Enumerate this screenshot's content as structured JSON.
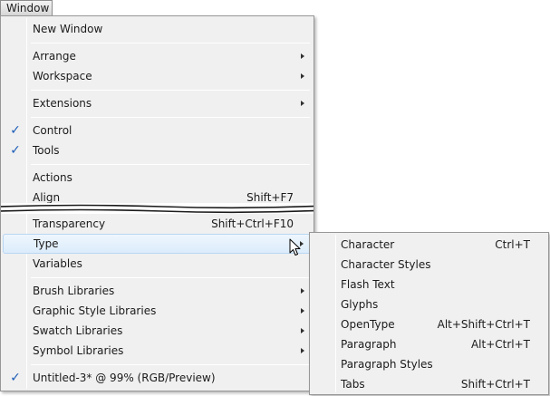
{
  "menubar": {
    "title": "Window"
  },
  "main_menu": {
    "items": [
      {
        "label": "New Window",
        "shortcut": "",
        "submenu": false,
        "checked": false
      },
      {
        "label": "Arrange",
        "shortcut": "",
        "submenu": true,
        "checked": false
      },
      {
        "label": "Workspace",
        "shortcut": "",
        "submenu": true,
        "checked": false
      },
      {
        "label": "Extensions",
        "shortcut": "",
        "submenu": true,
        "checked": false
      },
      {
        "label": "Control",
        "shortcut": "",
        "submenu": false,
        "checked": true
      },
      {
        "label": "Tools",
        "shortcut": "",
        "submenu": false,
        "checked": true
      },
      {
        "label": "Actions",
        "shortcut": "",
        "submenu": false,
        "checked": false
      },
      {
        "label": "Align",
        "shortcut": "Shift+F7",
        "submenu": false,
        "checked": false
      },
      {
        "label": "Transparency",
        "shortcut": "Shift+Ctrl+F10",
        "submenu": false,
        "checked": false
      },
      {
        "label": "Type",
        "shortcut": "",
        "submenu": true,
        "checked": false,
        "highlighted": true
      },
      {
        "label": "Variables",
        "shortcut": "",
        "submenu": false,
        "checked": false
      },
      {
        "label": "Brush Libraries",
        "shortcut": "",
        "submenu": true,
        "checked": false
      },
      {
        "label": "Graphic Style Libraries",
        "shortcut": "",
        "submenu": true,
        "checked": false
      },
      {
        "label": "Swatch Libraries",
        "shortcut": "",
        "submenu": true,
        "checked": false
      },
      {
        "label": "Symbol Libraries",
        "shortcut": "",
        "submenu": true,
        "checked": false
      },
      {
        "label": "Untitled-3* @ 99% (RGB/Preview)",
        "shortcut": "",
        "submenu": false,
        "checked": true
      }
    ]
  },
  "type_submenu": {
    "items": [
      {
        "label": "Character",
        "shortcut": "Ctrl+T"
      },
      {
        "label": "Character Styles",
        "shortcut": ""
      },
      {
        "label": "Flash Text",
        "shortcut": ""
      },
      {
        "label": "Glyphs",
        "shortcut": ""
      },
      {
        "label": "OpenType",
        "shortcut": "Alt+Shift+Ctrl+T"
      },
      {
        "label": "Paragraph",
        "shortcut": "Alt+Ctrl+T"
      },
      {
        "label": "Paragraph Styles",
        "shortcut": ""
      },
      {
        "label": "Tabs",
        "shortcut": "Shift+Ctrl+T"
      }
    ]
  },
  "icons": {
    "check": "checkmark-icon",
    "submenu_arrow": "chevron-right-icon",
    "cursor": "mouse-pointer-icon"
  },
  "colors": {
    "menu_bg": "#f0f0f0",
    "highlight_bg": "#dcecfb",
    "highlight_border": "#b9d6f3",
    "check": "#1e5fb8"
  }
}
